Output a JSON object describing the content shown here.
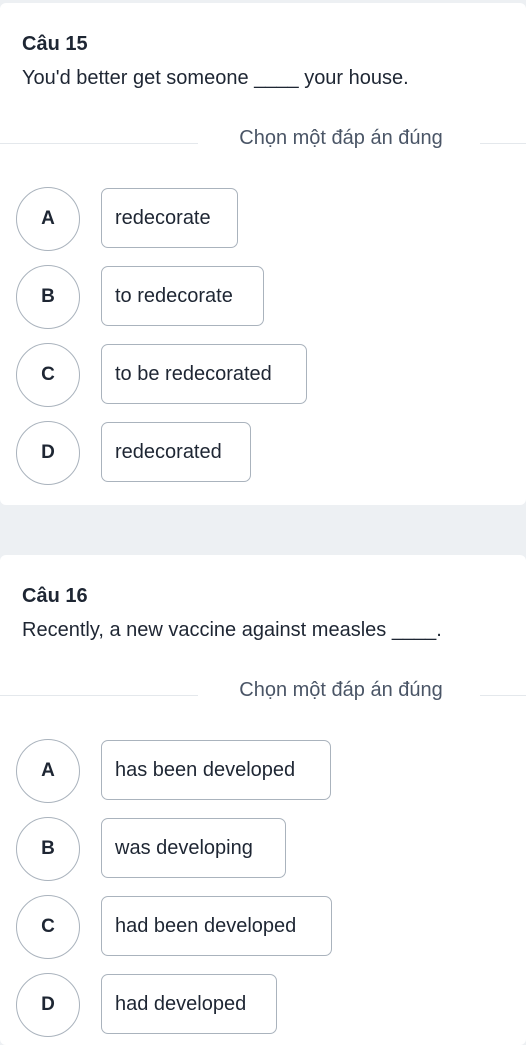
{
  "questions": [
    {
      "title": "Câu 15",
      "text": "You'd better get someone ____ your house.",
      "instruction": "Chọn một đáp án đúng",
      "options": [
        {
          "letter": "A",
          "text": "redecorate"
        },
        {
          "letter": "B",
          "text": "to redecorate"
        },
        {
          "letter": "C",
          "text": "to be redecorated"
        },
        {
          "letter": "D",
          "text": "redecorated"
        }
      ]
    },
    {
      "title": "Câu 16",
      "text": "Recently, a new vaccine against measles ____.",
      "instruction": "Chọn một đáp án đúng",
      "options": [
        {
          "letter": "A",
          "text": "has been developed"
        },
        {
          "letter": "B",
          "text": "was developing"
        },
        {
          "letter": "C",
          "text": "had been developed"
        },
        {
          "letter": "D",
          "text": "had developed"
        }
      ]
    }
  ]
}
